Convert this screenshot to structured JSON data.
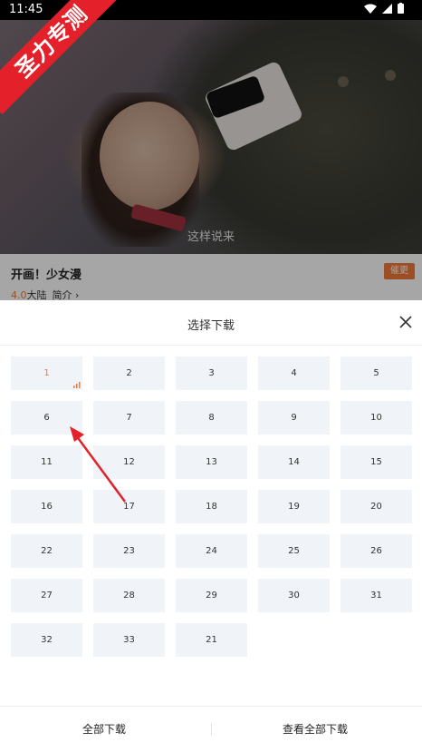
{
  "status_bar": {
    "time": "11:45"
  },
  "watermark": "圣力专测",
  "video": {
    "subtitle": "这样说来"
  },
  "show": {
    "title": "开画！少女漫",
    "score": "4.0",
    "region": "大陆",
    "intro_label": "简介",
    "follow_label": "催更"
  },
  "sheet": {
    "title": "选择下载",
    "episodes": [
      "1",
      "2",
      "3",
      "4",
      "5",
      "6",
      "7",
      "8",
      "9",
      "10",
      "11",
      "12",
      "13",
      "14",
      "15",
      "16",
      "17",
      "18",
      "19",
      "20",
      "22",
      "23",
      "24",
      "25",
      "26",
      "27",
      "28",
      "29",
      "30",
      "31",
      "32",
      "33",
      "21"
    ],
    "active_episode": "1",
    "download_all_label": "全部下载",
    "view_all_label": "查看全部下载"
  },
  "colors": {
    "accent": "#f07a3a",
    "ribbon": "#e4212a",
    "arrow": "#e4212a"
  }
}
